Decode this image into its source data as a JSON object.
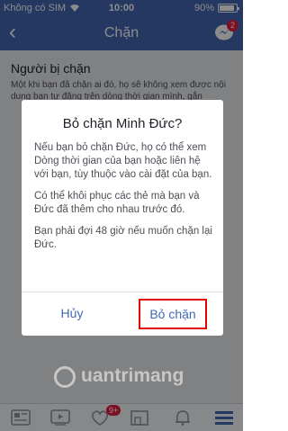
{
  "status_bar": {
    "carrier": "Không có SIM",
    "time": "10:00",
    "battery": "90%"
  },
  "nav": {
    "back_icon": "chevron-left-icon",
    "title": "Chặn",
    "messenger_badge": "2"
  },
  "page": {
    "heading": "Người bị chặn",
    "description": "Một khi bạn đã chặn ai đó, họ sẽ không xem được nội dung bạn tự đăng trên dòng thời gian mình, gắn"
  },
  "dialog": {
    "title": "Bỏ chặn Minh Đức?",
    "paragraphs": [
      "Nếu bạn bỏ chặn Đức, họ có thể xem Dòng thời gian của bạn hoặc liên hệ với bạn, tùy thuộc vào cài đặt của bạn.",
      "Có thể khôi phục các thẻ mà bạn và Đức đã thêm cho nhau trước đó.",
      "Bạn phải đợi 48 giờ nếu muốn chặn lại Đức."
    ],
    "cancel_label": "Hủy",
    "confirm_label": "Bỏ chặn"
  },
  "tab_bar": {
    "tabs": [
      "news-feed-icon",
      "watch-icon",
      "friends-icon",
      "marketplace-icon",
      "notifications-icon",
      "menu-icon"
    ],
    "friends_badge": "9+"
  },
  "watermark": "uantrimang",
  "colors": {
    "brand": "#4267b2",
    "highlight": "#e00000",
    "badge": "#e41e3f"
  }
}
